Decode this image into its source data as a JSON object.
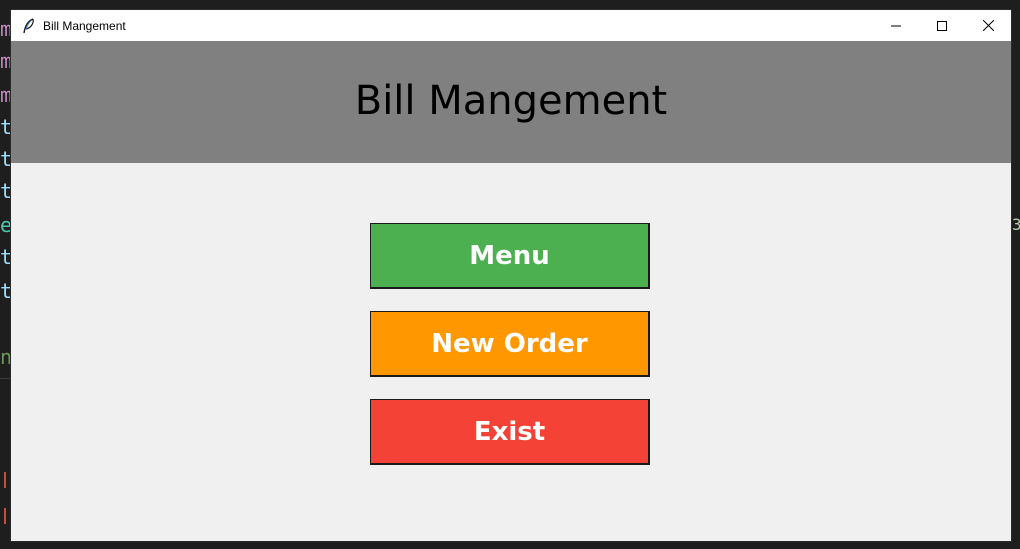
{
  "background_editor": {
    "lines": [
      "m",
      "m",
      "m",
      "t",
      "t",
      "t",
      "e",
      "t",
      "t",
      "n"
    ],
    "right_char": "3"
  },
  "window": {
    "title": "Bill Mangement",
    "app_icon": "feather-icon",
    "controls": {
      "minimize_icon": "minimize-icon",
      "maximize_icon": "maximize-icon",
      "close_icon": "close-icon"
    }
  },
  "header": {
    "title": "Bill Mangement",
    "background": "#808080"
  },
  "buttons": [
    {
      "label": "Menu",
      "color": "#4caf50"
    },
    {
      "label": "New Order",
      "color": "#ff9800"
    },
    {
      "label": "Exist",
      "color": "#f44336"
    }
  ],
  "colors": {
    "window_bg": "#f0f0f0",
    "titlebar_bg": "#ffffff",
    "button_text": "#ffffff"
  }
}
